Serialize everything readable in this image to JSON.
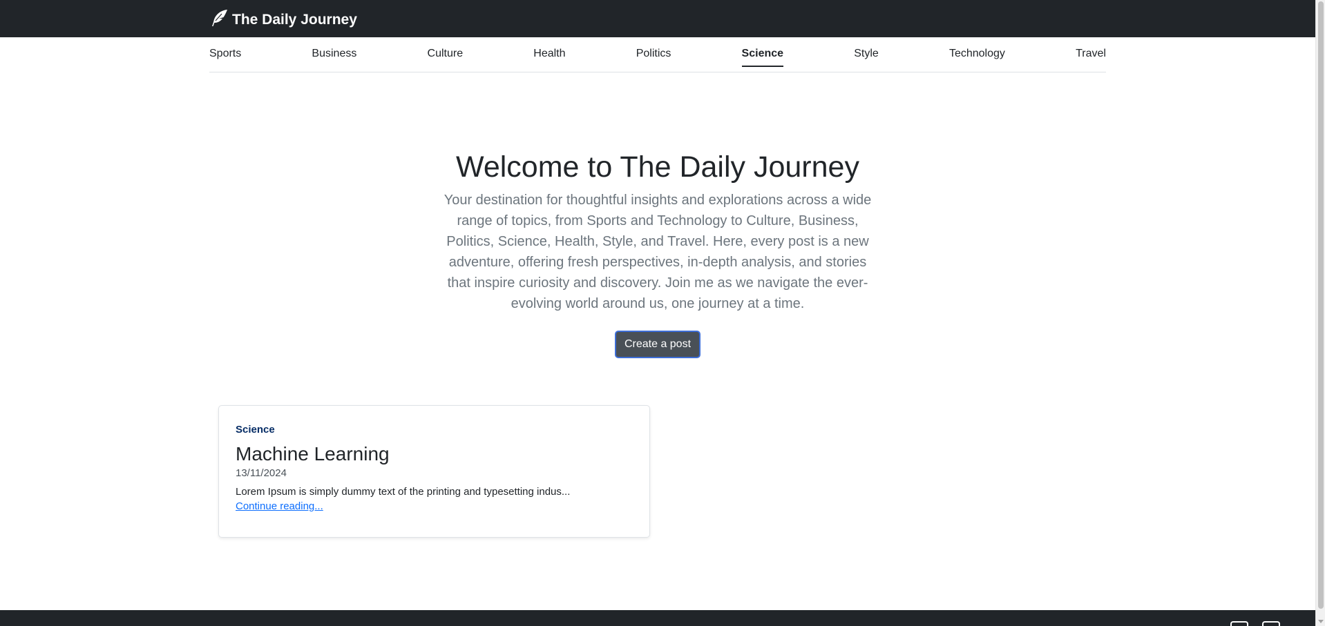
{
  "header": {
    "brand": "The Daily Journey",
    "brand_icon": "feather-icon",
    "bg_color": "#212529"
  },
  "categories": [
    {
      "label": "Sports",
      "active": false
    },
    {
      "label": "Business",
      "active": false
    },
    {
      "label": "Culture",
      "active": false
    },
    {
      "label": "Health",
      "active": false
    },
    {
      "label": "Politics",
      "active": false
    },
    {
      "label": "Science",
      "active": true
    },
    {
      "label": "Style",
      "active": false
    },
    {
      "label": "Technology",
      "active": false
    },
    {
      "label": "Travel",
      "active": false
    }
  ],
  "hero": {
    "title": "Welcome to The Daily Journey",
    "description": "Your destination for thoughtful insights and explorations across a wide range of topics, from Sports and Technology to Culture, Business, Politics, Science, Health, Style, and Travel. Here, every post is a new adventure, offering fresh perspectives, in-depth analysis, and stories that inspire curiosity and discovery. Join me as we navigate the ever-evolving world around us, one journey at a time.",
    "cta_label": "Create a post"
  },
  "posts": [
    {
      "category": "Science",
      "title": "Machine Learning",
      "date": "13/11/2024",
      "excerpt": "Lorem Ipsum is simply dummy text of the printing and typesetting indus...",
      "link_label": "Continue reading..."
    }
  ],
  "footer": {
    "icons": [
      "social-icon-1",
      "social-icon-2"
    ]
  }
}
